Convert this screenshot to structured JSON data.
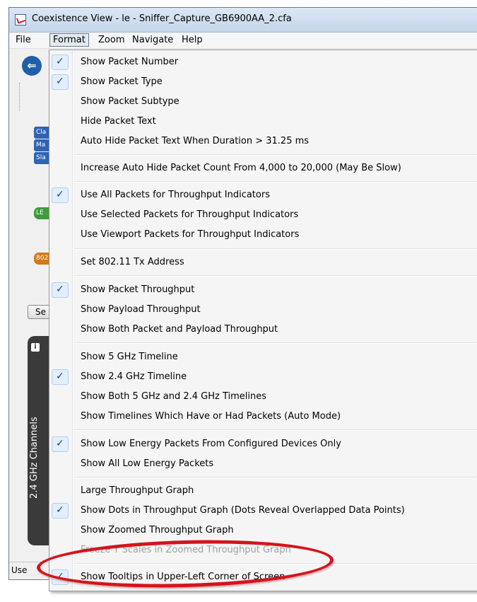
{
  "window": {
    "title": "Coexistence View - le - Sniffer_Capture_GB6900AA_2.cfa"
  },
  "menubar": {
    "file": "File",
    "format": "Format",
    "zoom": "Zoom",
    "navigate": "Navigate",
    "help": "Help"
  },
  "background": {
    "tags": [
      "Cla",
      "Ma",
      "Sla",
      "LE",
      "802"
    ],
    "se_button": "Se",
    "channels_label": "2.4 GHz Channels",
    "status_text": "Use"
  },
  "format_menu": {
    "items": [
      {
        "label": "Show Packet Number",
        "checked": true
      },
      {
        "label": "Show Packet Type",
        "checked": true
      },
      {
        "label": "Show Packet Subtype",
        "checked": false
      },
      {
        "label": "Hide Packet Text",
        "checked": false
      },
      {
        "label": "Auto Hide Packet Text When Duration > 31.25 ms",
        "checked": false
      },
      {
        "label": "Increase Auto Hide Packet Count From 4,000 to 20,000 (May Be Slow)",
        "checked": false
      },
      {
        "label": "Use All Packets for Throughput Indicators",
        "checked": true
      },
      {
        "label": "Use Selected Packets for Throughput Indicators",
        "checked": false
      },
      {
        "label": "Use Viewport Packets for Throughput Indicators",
        "checked": false
      },
      {
        "label": "Set 802.11 Tx Address",
        "checked": false
      },
      {
        "label": "Show Packet Throughput",
        "checked": true
      },
      {
        "label": "Show Payload Throughput",
        "checked": false
      },
      {
        "label": "Show Both Packet and Payload Throughput",
        "checked": false
      },
      {
        "label": "Show 5 GHz Timeline",
        "checked": false
      },
      {
        "label": "Show 2.4 GHz Timeline",
        "checked": true
      },
      {
        "label": "Show Both 5 GHz and 2.4 GHz Timelines",
        "checked": false
      },
      {
        "label": "Show Timelines Which Have or Had Packets (Auto Mode)",
        "checked": false
      },
      {
        "label": "Show Low Energy Packets From Configured Devices Only",
        "checked": true
      },
      {
        "label": "Show All Low Energy Packets",
        "checked": false
      },
      {
        "label": "Large Throughput Graph",
        "checked": false
      },
      {
        "label": "Show Dots in Throughput Graph (Dots Reveal Overlapped Data Points)",
        "checked": true
      },
      {
        "label": "Show Zoomed Throughput Graph",
        "checked": false
      },
      {
        "label": "Freeze Y Scales in Zoomed Throughput Graph",
        "checked": false,
        "disabled": true
      },
      {
        "label": "Show Tooltips in Upper-Left Corner of Screen",
        "checked": true
      }
    ],
    "check_glyph": "✓"
  },
  "annotation": {
    "highlighted_item": "Show Tooltips in Upper-Left Corner of Screen",
    "color": "#d4141c"
  }
}
